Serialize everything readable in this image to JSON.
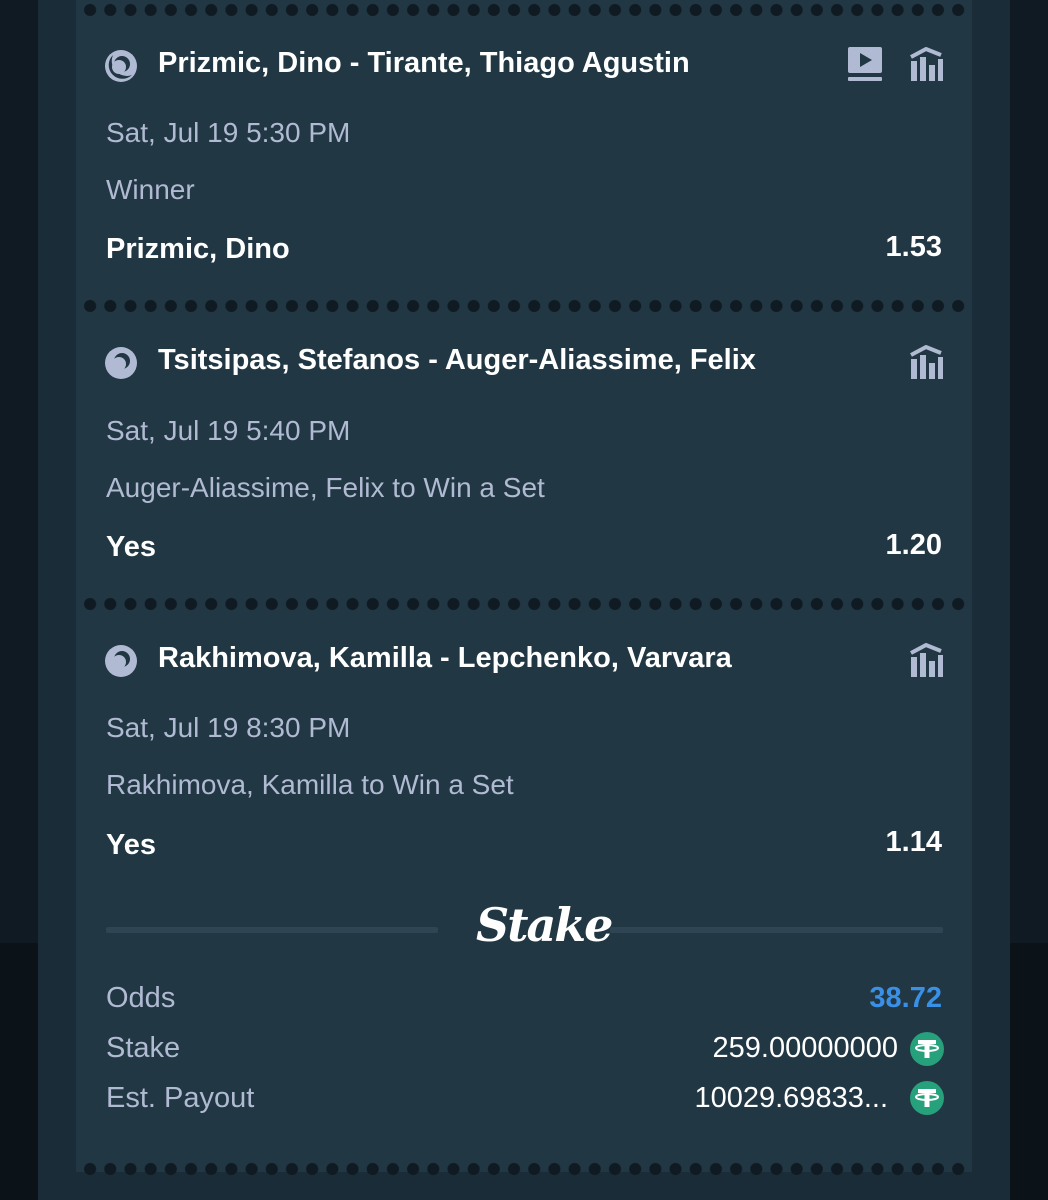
{
  "bets": [
    {
      "match": "Prizmic, Dino - Tirante, Thiago Agustin",
      "date": "Sat, Jul 19 5:30 PM",
      "market": "Winner",
      "selection": "Prizmic, Dino",
      "odds": "1.53",
      "icons": [
        "tennis-ball-icon",
        "live-stream-icon",
        "stats-icon"
      ]
    },
    {
      "match": "Tsitsipas, Stefanos - Auger-Aliassime, Felix",
      "date": "Sat, Jul 19 5:40 PM",
      "market": "Auger-Aliassime, Felix to Win a Set",
      "selection": "Yes",
      "odds": "1.20",
      "icons": [
        "tennis-ball-icon",
        "stats-icon"
      ]
    },
    {
      "match": "Rakhimova, Kamilla - Lepchenko, Varvara",
      "date": "Sat, Jul 19 8:30 PM",
      "market": "Rakhimova, Kamilla to Win a Set",
      "selection": "Yes",
      "odds": "1.14",
      "icons": [
        "tennis-ball-icon",
        "stats-icon"
      ]
    }
  ],
  "brand": "Stake",
  "summary": {
    "odds_label": "Odds",
    "odds_value": "38.72",
    "stake_label": "Stake",
    "stake_value": "259.00000000",
    "payout_label": "Est. Payout",
    "payout_value": "10029.69833...",
    "currency_icon": "tether-usdt-icon"
  },
  "colors": {
    "background": "#0f1a22",
    "ticket": "#213743",
    "text_primary": "#ffffff",
    "text_secondary": "#b1bad3",
    "odds_accent": "#3a90e6",
    "tether_green": "#26a17b"
  }
}
